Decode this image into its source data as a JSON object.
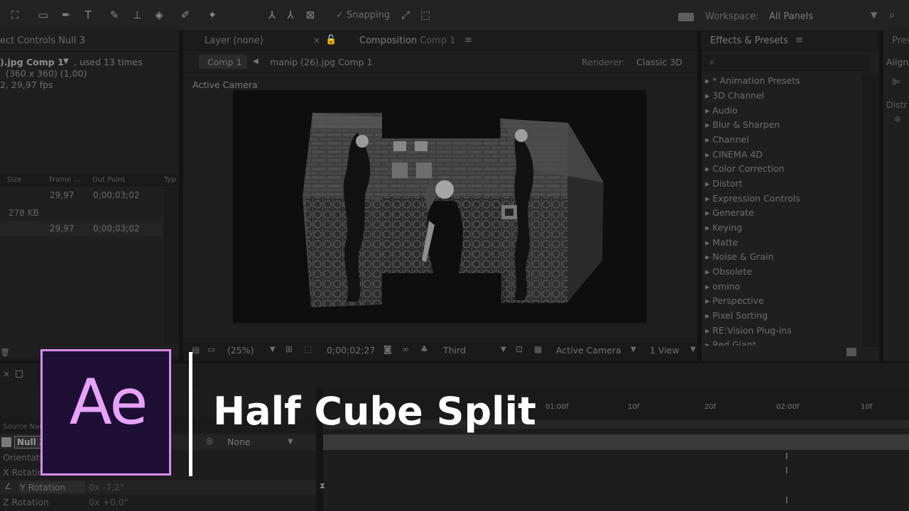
{
  "toolbar": {
    "snapping_label": "Snapping",
    "workspace_label": "Workspace:",
    "workspace_value": "All Panels"
  },
  "left_panel": {
    "tab_label": "ect Controls Null 3",
    "file_name": ").jpg Comp 1",
    "used_text": ", used 13 times",
    "dimensions": "(360 x 360) (1,00)",
    "fps": "2, 29,97 fps",
    "columns": [
      "Size",
      "Frame ...",
      "Out Point",
      "Typ"
    ],
    "rows": [
      {
        "size": "",
        "frame": "29,97",
        "out": "0;00;03;02"
      },
      {
        "size": "278 KB",
        "frame": "",
        "out": ""
      },
      {
        "size": "",
        "frame": "29,97",
        "out": "0;00;03;02"
      }
    ]
  },
  "comp_panel": {
    "layer_tab": "Layer (none)",
    "comp_tab": "Composition",
    "comp_tab_name": "Comp 1",
    "breadcrumb_1": "Comp 1",
    "breadcrumb_2": "manip (26).jpg Comp 1",
    "renderer_label": "Renderer:",
    "renderer_value": "Classic 3D",
    "view_label": "Active Camera"
  },
  "viewer_bar": {
    "zoom": "(25%)",
    "timecode": "0;00;02;27",
    "resolution": "Third",
    "camera": "Active Camera",
    "views": "1 View"
  },
  "effects_panel": {
    "title": "Effects & Presets",
    "items": [
      "* Animation Presets",
      "3D Channel",
      "Audio",
      "Blur & Sharpen",
      "Channel",
      "CINEMA 4D",
      "Color Correction",
      "Distort",
      "Expression Controls",
      "Generate",
      "Keying",
      "Matte",
      "Noise & Grain",
      "Obsolete",
      "omino",
      "Perspective",
      "Pixel Sorting",
      "RE:Vision Plug-ins",
      "Red Giant"
    ]
  },
  "right_panel": {
    "preview_tab": "Prev",
    "align_label": "Align",
    "distribute_label": "Distr"
  },
  "timeline": {
    "source_name_label": "Source Nam",
    "layer_name": "Null 3",
    "parent_value": "None",
    "ruler": [
      "01:00f",
      "10f",
      "20f",
      "02:00f",
      "10f"
    ],
    "properties": [
      {
        "name": "Orientation",
        "value": ""
      },
      {
        "name": "X Rotation",
        "value": ""
      },
      {
        "name": "Y Rotation",
        "value": "0x -7,2°"
      },
      {
        "name": "Z Rotation",
        "value": "0x +0,0°"
      }
    ]
  },
  "overlay": {
    "logo_text": "Ae",
    "title": "Half Cube Split"
  },
  "colors": {
    "logo_border": "#d98bf4",
    "logo_fill": "#1e0f34",
    "logo_text": "#e7a2fb",
    "accent_blue": "#4a6ea8"
  }
}
